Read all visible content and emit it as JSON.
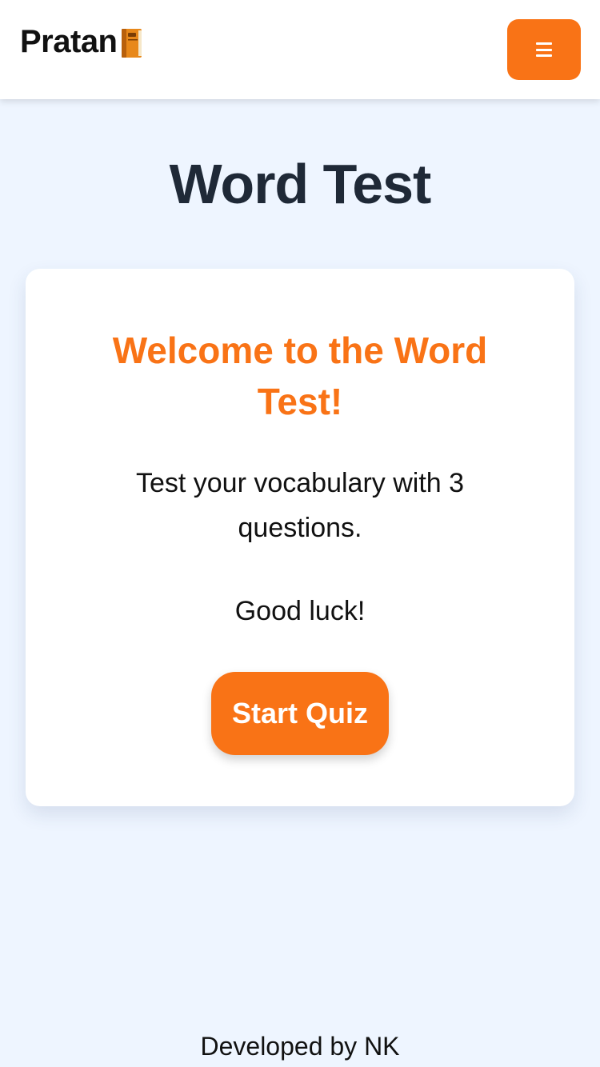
{
  "header": {
    "brand": "Pratan",
    "brand_icon": "orange-book-icon",
    "menu_icon": "hamburger-menu-icon"
  },
  "page": {
    "title": "Word Test"
  },
  "card": {
    "heading": "Welcome to the Word Test!",
    "description": "Test your vocabulary with 3 questions.",
    "luck": "Good luck!",
    "start_button": "Start Quiz"
  },
  "footer": {
    "text": "Developed by NK"
  },
  "colors": {
    "accent": "#f97316",
    "background": "#eef5ff",
    "title": "#1f2937"
  }
}
